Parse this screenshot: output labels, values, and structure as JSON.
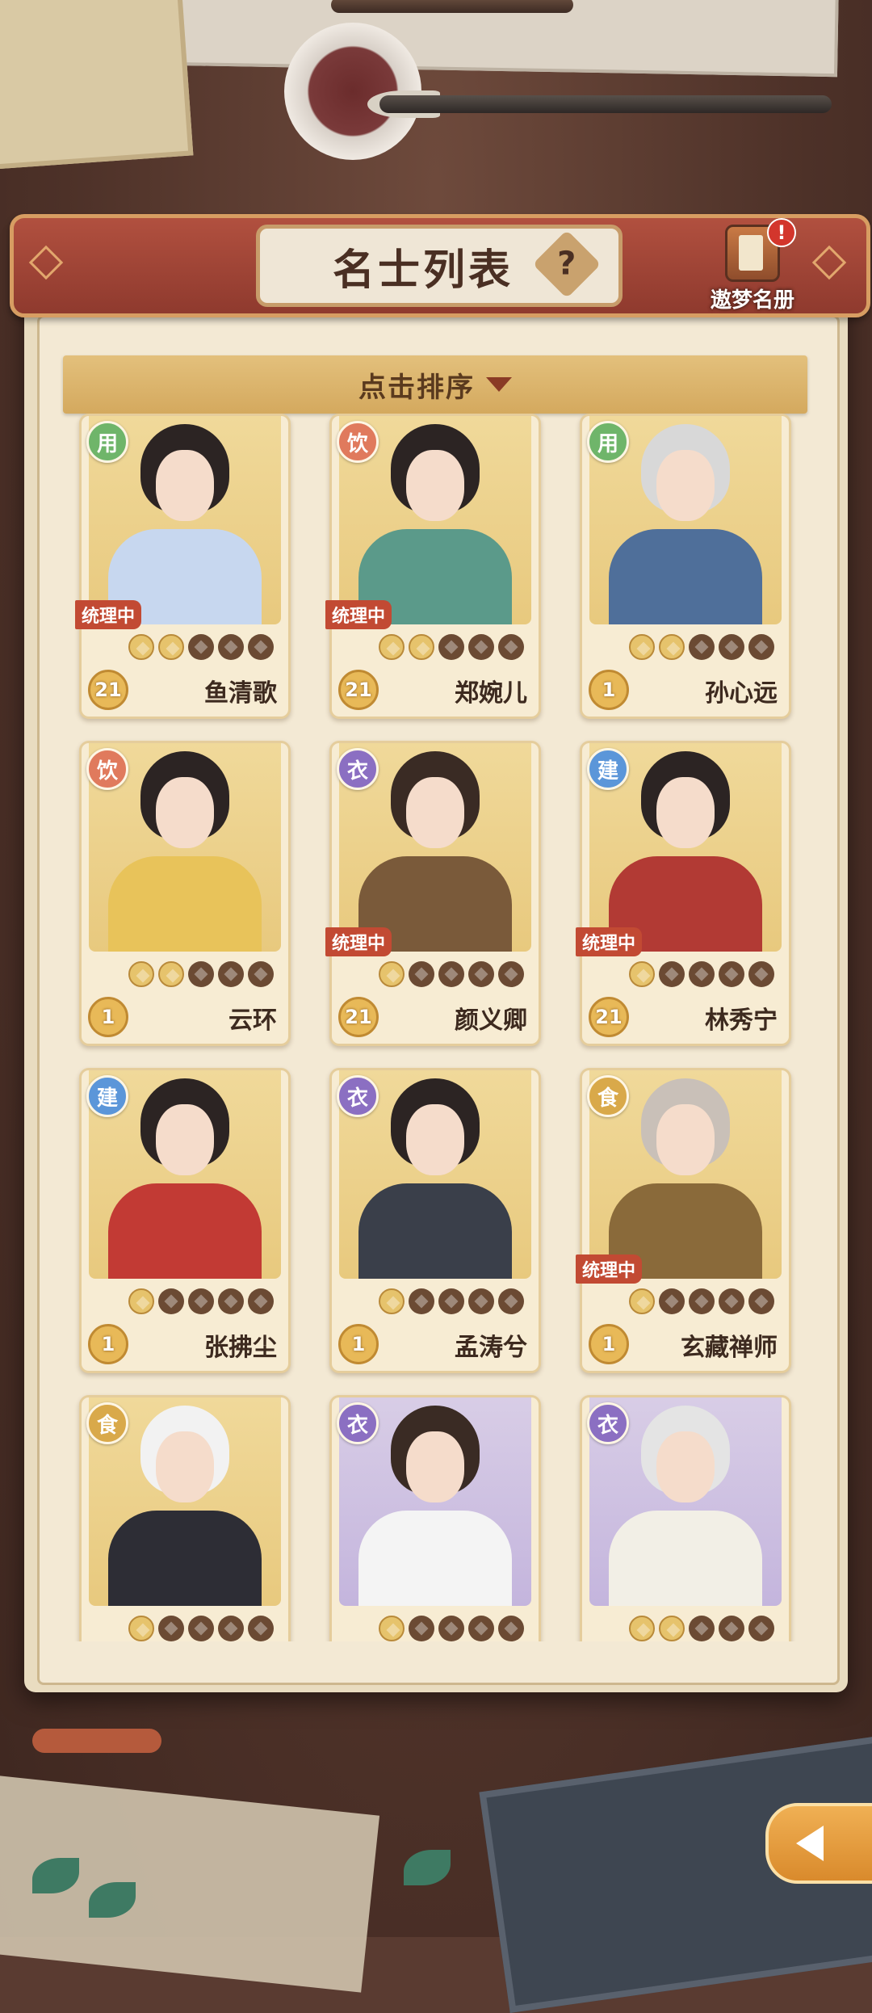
{
  "header": {
    "title": "名士列表",
    "help_icon": "?",
    "register_label": "遨梦名册",
    "register_badge": "!"
  },
  "sort": {
    "label": "点击排序"
  },
  "colors": {
    "role_用": "#6fb56a",
    "role_饮": "#e07a5d",
    "role_衣": "#8b6fc2",
    "role_建": "#5b96d9",
    "role_食": "#d9a94a"
  },
  "cards": [
    {
      "role": "用",
      "name": "鱼清歌",
      "level": "21",
      "status": "统理中",
      "stars_lit": 2,
      "stars_total": 5,
      "bg": "gold"
    },
    {
      "role": "饮",
      "name": "郑婉儿",
      "level": "21",
      "status": "统理中",
      "stars_lit": 2,
      "stars_total": 5,
      "bg": "gold"
    },
    {
      "role": "用",
      "name": "孙心远",
      "level": "1",
      "status": "",
      "stars_lit": 2,
      "stars_total": 5,
      "bg": "gold"
    },
    {
      "role": "饮",
      "name": "云环",
      "level": "1",
      "status": "",
      "stars_lit": 2,
      "stars_total": 5,
      "bg": "gold"
    },
    {
      "role": "衣",
      "name": "颜义卿",
      "level": "21",
      "status": "统理中",
      "stars_lit": 1,
      "stars_total": 5,
      "bg": "gold"
    },
    {
      "role": "建",
      "name": "林秀宁",
      "level": "21",
      "status": "统理中",
      "stars_lit": 1,
      "stars_total": 5,
      "bg": "gold"
    },
    {
      "role": "建",
      "name": "张拂尘",
      "level": "1",
      "status": "",
      "stars_lit": 1,
      "stars_total": 5,
      "bg": "gold"
    },
    {
      "role": "衣",
      "name": "孟涛兮",
      "level": "1",
      "status": "",
      "stars_lit": 1,
      "stars_total": 5,
      "bg": "gold"
    },
    {
      "role": "食",
      "name": "玄藏禅师",
      "level": "1",
      "status": "统理中",
      "stars_lit": 1,
      "stars_total": 5,
      "bg": "gold"
    },
    {
      "role": "食",
      "name": "",
      "level": "",
      "status": "",
      "stars_lit": 1,
      "stars_total": 5,
      "bg": "gold"
    },
    {
      "role": "衣",
      "name": "",
      "level": "",
      "status": "",
      "stars_lit": 1,
      "stars_total": 5,
      "bg": "purple"
    },
    {
      "role": "衣",
      "name": "",
      "level": "",
      "status": "",
      "stars_lit": 2,
      "stars_total": 5,
      "bg": "purple"
    }
  ]
}
